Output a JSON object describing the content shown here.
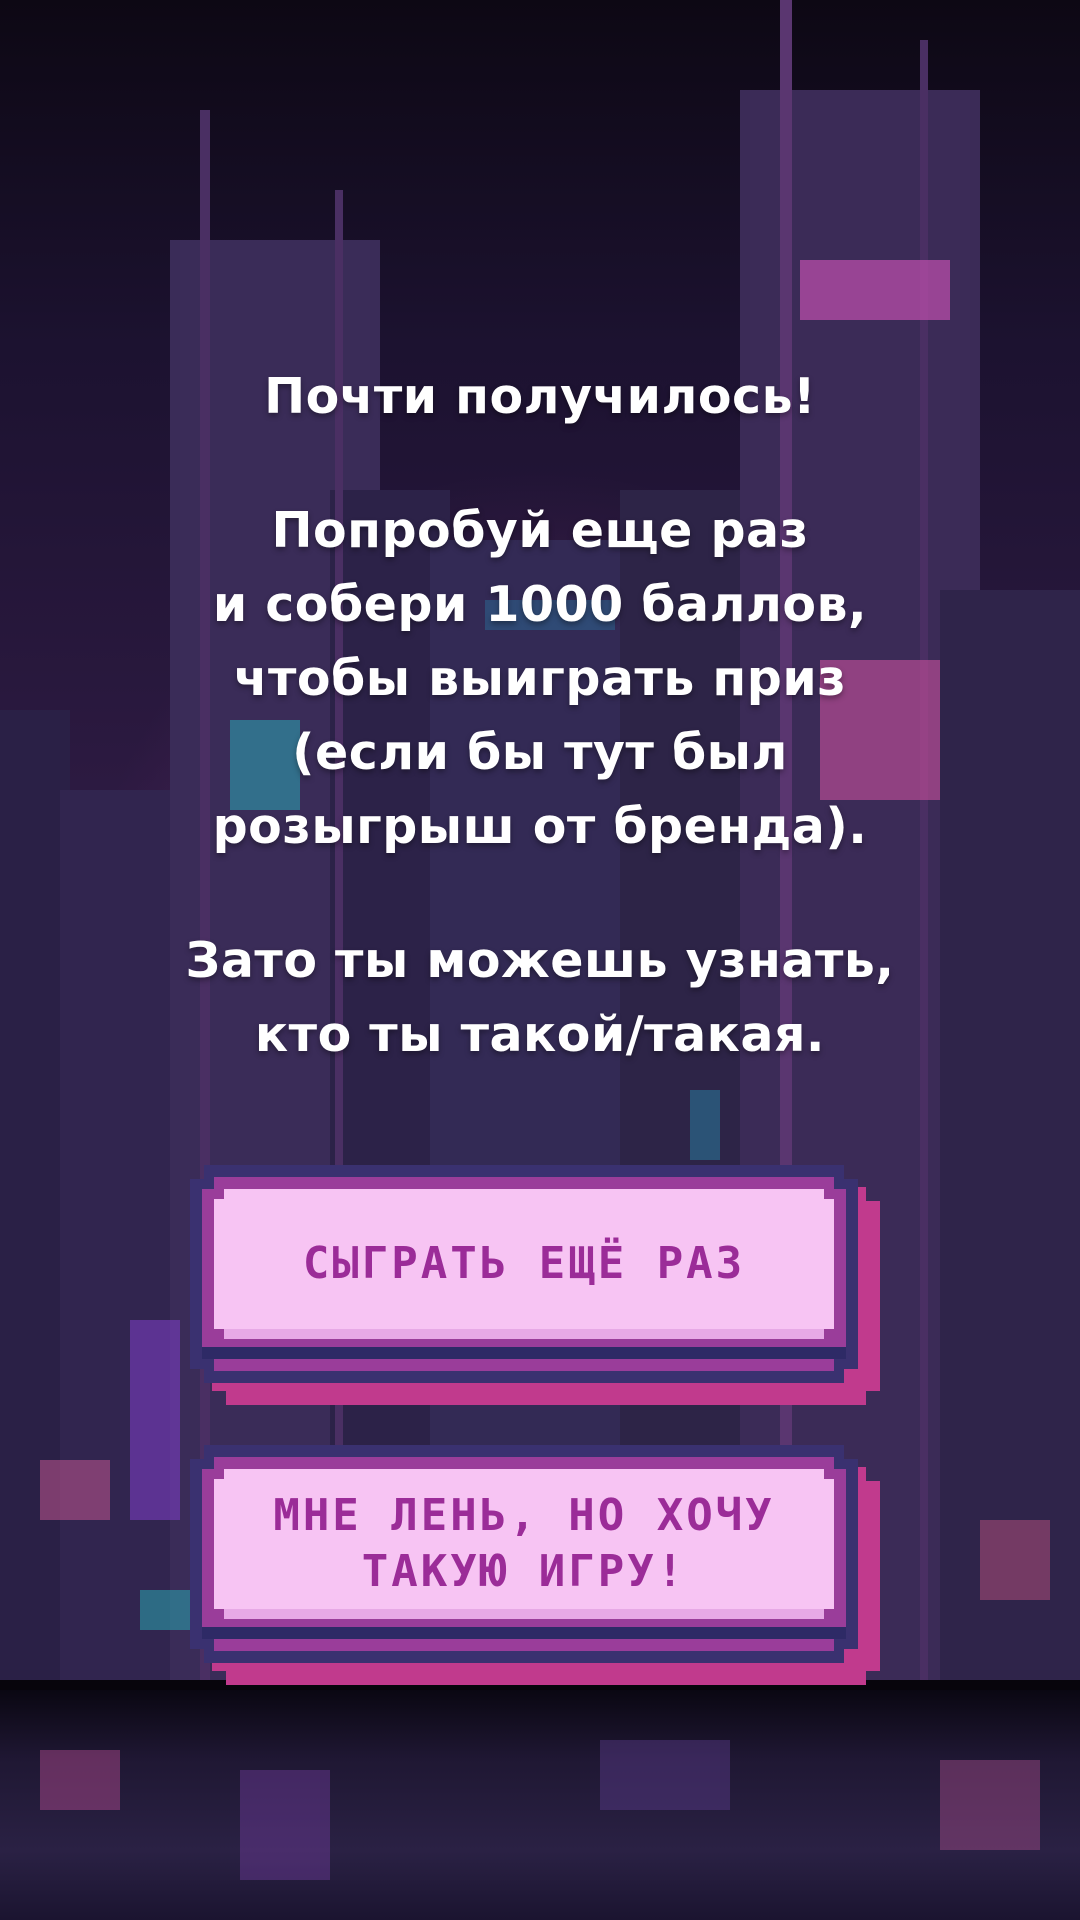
{
  "message": {
    "title": "Почти получилось!",
    "paragraph2": [
      "Попробуй еще раз",
      "и собери 1000 баллов,",
      "чтобы выиграть приз",
      "(если бы тут был",
      "розыгрыш от бренда)."
    ],
    "paragraph3": [
      "Зато ты можешь узнать,",
      "кто ты такой/такая."
    ]
  },
  "buttons": {
    "play_again": "СЫГРАТЬ ЕЩЁ РАЗ",
    "want_game": "МНЕ ЛЕНЬ, НО ХОЧУ\nТАКУЮ ИГРУ!"
  },
  "colors": {
    "button_face": "#f7c4f3",
    "button_text": "#9b2c98",
    "button_border": "#3a3170",
    "button_shadow": "#c13a8d",
    "text": "#ffffff"
  }
}
